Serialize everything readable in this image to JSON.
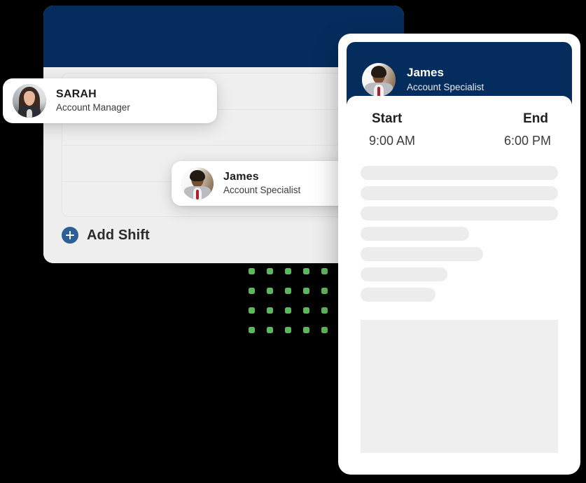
{
  "theme": {
    "navy": "#042d5e",
    "accent_blue": "#2c5f96",
    "dot_green": "#5cb85c",
    "skeleton_gray": "#ececec",
    "panel_gray": "#eeeeee"
  },
  "left_window": {
    "name": "shift-schedule-window",
    "header_color": "#042d5e",
    "table": {
      "row_count": 4
    },
    "add_shift": {
      "icon": "plus-icon",
      "label": "Add Shift"
    }
  },
  "person_chips": [
    {
      "id": "sarah",
      "name": "SARAH",
      "role": "Account Manager",
      "avatar_icon": "avatar-sarah"
    },
    {
      "id": "james",
      "name": "James",
      "role": "Account Specialist",
      "avatar_icon": "avatar-james"
    }
  ],
  "dot_grid": {
    "columns": 5,
    "rows": 4,
    "color": "#5cb85c",
    "total": 20
  },
  "right_panel": {
    "header": {
      "name": "James",
      "role": "Account Specialist",
      "avatar_icon": "avatar-james"
    },
    "shift": {
      "start_label": "Start",
      "end_label": "End",
      "start_value": "9:00 AM",
      "end_value": "6:00 PM"
    },
    "skeleton_bars": [
      {
        "width_pct": 100
      },
      {
        "width_pct": 100
      },
      {
        "width_pct": 100
      },
      {
        "width_pct": 55
      },
      {
        "width_pct": 62
      },
      {
        "width_pct": 44
      },
      {
        "width_pct": 38
      }
    ],
    "placeholder_block": {
      "name": "content-placeholder"
    }
  }
}
